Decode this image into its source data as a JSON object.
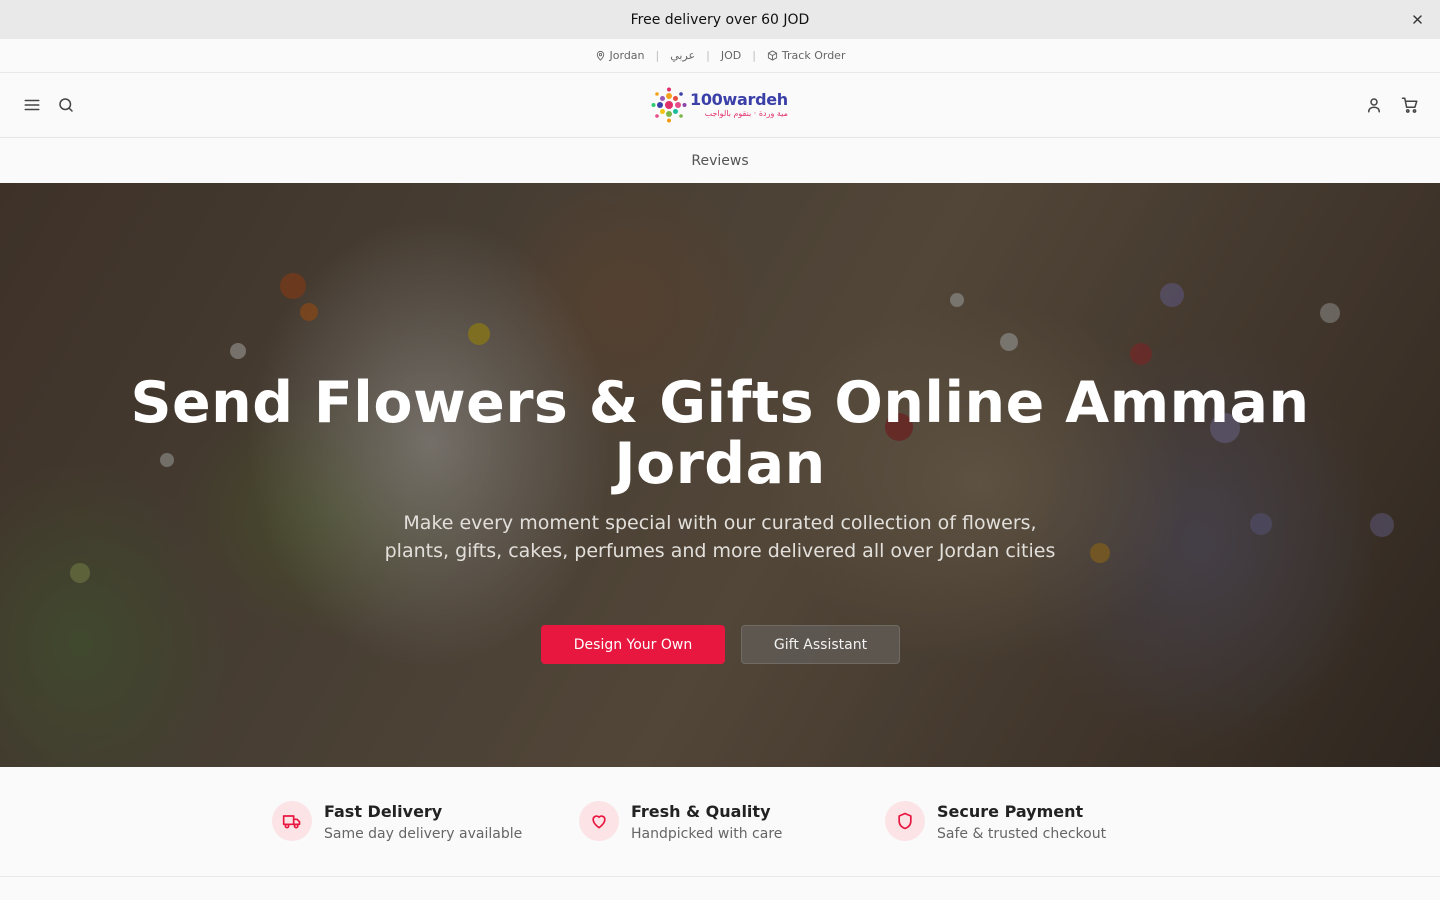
{
  "promo": {
    "text": "Free delivery over 60 JOD"
  },
  "utility": {
    "country": "Jordan",
    "language": "عربي",
    "currency": "JOD",
    "track_order": "Track Order"
  },
  "header": {
    "logo_main": "100wardeh",
    "logo_sub": "مية وردة · بنقوم بالواجب"
  },
  "nav": {
    "reviews": "Reviews"
  },
  "hero": {
    "title_line1": "Send Flowers & Gifts Online Amman",
    "title_line2": "Jordan",
    "subtitle": "Make every moment special with our curated collection of flowers, plants, gifts, cakes, perfumes and more delivered all over Jordan cities",
    "primary_button": "Design Your Own",
    "secondary_button": "Gift Assistant"
  },
  "features": [
    {
      "title": "Fast Delivery",
      "desc": "Same day delivery available",
      "icon": "truck-icon"
    },
    {
      "title": "Fresh & Quality",
      "desc": "Handpicked with care",
      "icon": "heart-icon"
    },
    {
      "title": "Secure Payment",
      "desc": "Safe & trusted checkout",
      "icon": "shield-icon"
    }
  ],
  "colors": {
    "accent": "#e8173f",
    "icon_bg": "#fbe3e6",
    "logo_blue": "#3b3fa8"
  }
}
